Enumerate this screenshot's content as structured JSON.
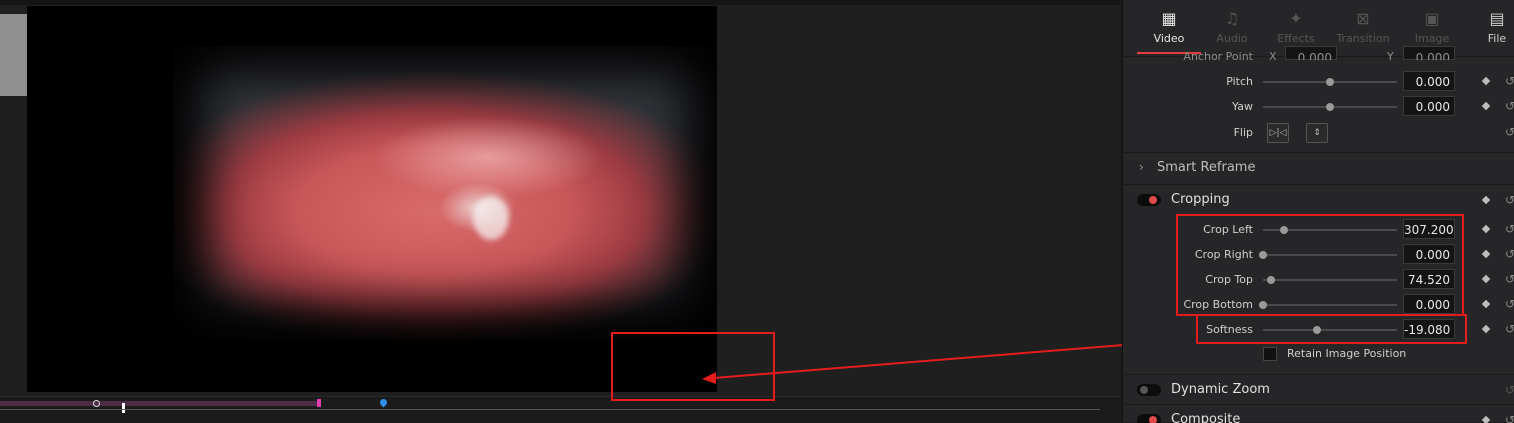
{
  "inspector": {
    "tabs": [
      {
        "label": "Video",
        "icon": "film-icon",
        "active": true
      },
      {
        "label": "Audio",
        "icon": "music-note-icon",
        "active": false
      },
      {
        "label": "Effects",
        "icon": "magic-wand-icon",
        "active": false
      },
      {
        "label": "Transition",
        "icon": "transition-icon",
        "active": false
      },
      {
        "label": "Image",
        "icon": "image-icon",
        "active": false
      },
      {
        "label": "File",
        "icon": "file-icon",
        "active": false
      }
    ],
    "anchor_point": {
      "label": "Anchor Point",
      "x_label": "X",
      "x_value": "0.000",
      "y_label": "Y",
      "y_value": "0.000"
    },
    "pitch": {
      "label": "Pitch",
      "value": "0.000",
      "level": 0.5
    },
    "yaw": {
      "label": "Yaw",
      "value": "0.000",
      "level": 0.5
    },
    "flip": {
      "label": "Flip"
    },
    "smart_reframe": {
      "title": "Smart Reframe"
    },
    "cropping": {
      "title": "Cropping",
      "enabled": true,
      "crop_left": {
        "label": "Crop Left",
        "value": "307.200",
        "level": 0.16
      },
      "crop_right": {
        "label": "Crop Right",
        "value": "0.000",
        "level": 0.0
      },
      "crop_top": {
        "label": "Crop Top",
        "value": "74.520",
        "level": 0.06
      },
      "crop_bottom": {
        "label": "Crop Bottom",
        "value": "0.000",
        "level": 0.0
      },
      "softness": {
        "label": "Softness",
        "value": "-19.080",
        "level": 0.4
      },
      "retain": {
        "label": "Retain Image Position",
        "checked": false
      }
    },
    "dynamic_zoom": {
      "title": "Dynamic Zoom",
      "enabled": false
    },
    "composite": {
      "title": "Composite",
      "enabled": true
    }
  },
  "colors": {
    "accent": "#e23c3c",
    "annotation": "#e51c1c",
    "panel": "#262628",
    "viewer_bg": "#1f1f20"
  }
}
